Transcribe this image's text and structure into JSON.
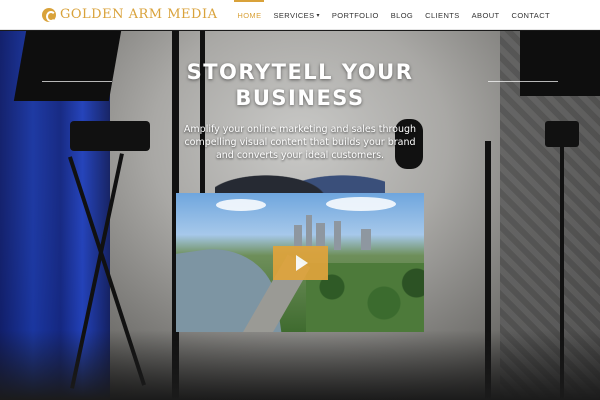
{
  "brand": {
    "name": "GOLDEN ARM MEDIA",
    "accent_color": "#d9a23a",
    "logo_icon": "golden-arm-logo-icon"
  },
  "nav": {
    "items": [
      {
        "label": "HOME",
        "active": true
      },
      {
        "label": "SERVICES",
        "has_dropdown": true
      },
      {
        "label": "PORTFOLIO"
      },
      {
        "label": "BLOG"
      },
      {
        "label": "CLIENTS"
      },
      {
        "label": "ABOUT"
      },
      {
        "label": "CONTACT"
      }
    ],
    "dropdown_icon": "chevron-down-icon"
  },
  "hero": {
    "title": "STORYTELL YOUR BUSINESS",
    "subtitle": "Amplify your online marketing and sales through compelling visual content that builds your brand and converts your ideal customers.",
    "video": {
      "play_icon": "play-icon",
      "play_button_color": "#e0a43c"
    }
  }
}
